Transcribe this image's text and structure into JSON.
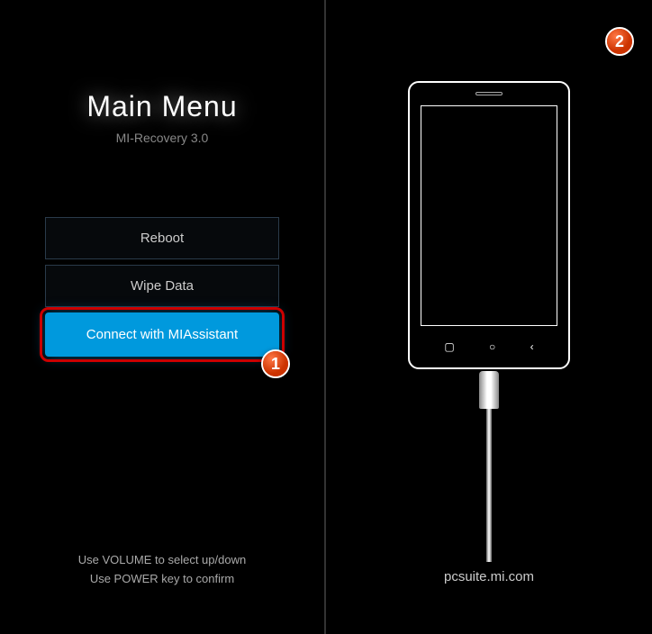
{
  "left": {
    "title": "Main Menu",
    "subtitle": "MI-Recovery 3.0",
    "menu": {
      "reboot": "Reboot",
      "wipe": "Wipe Data",
      "connect": "Connect with MIAssistant"
    },
    "footer_line1": "Use VOLUME to select up/down",
    "footer_line2": "Use POWER key to confirm"
  },
  "right": {
    "url": "pcsuite.mi.com"
  },
  "badges": {
    "one": "1",
    "two": "2"
  }
}
